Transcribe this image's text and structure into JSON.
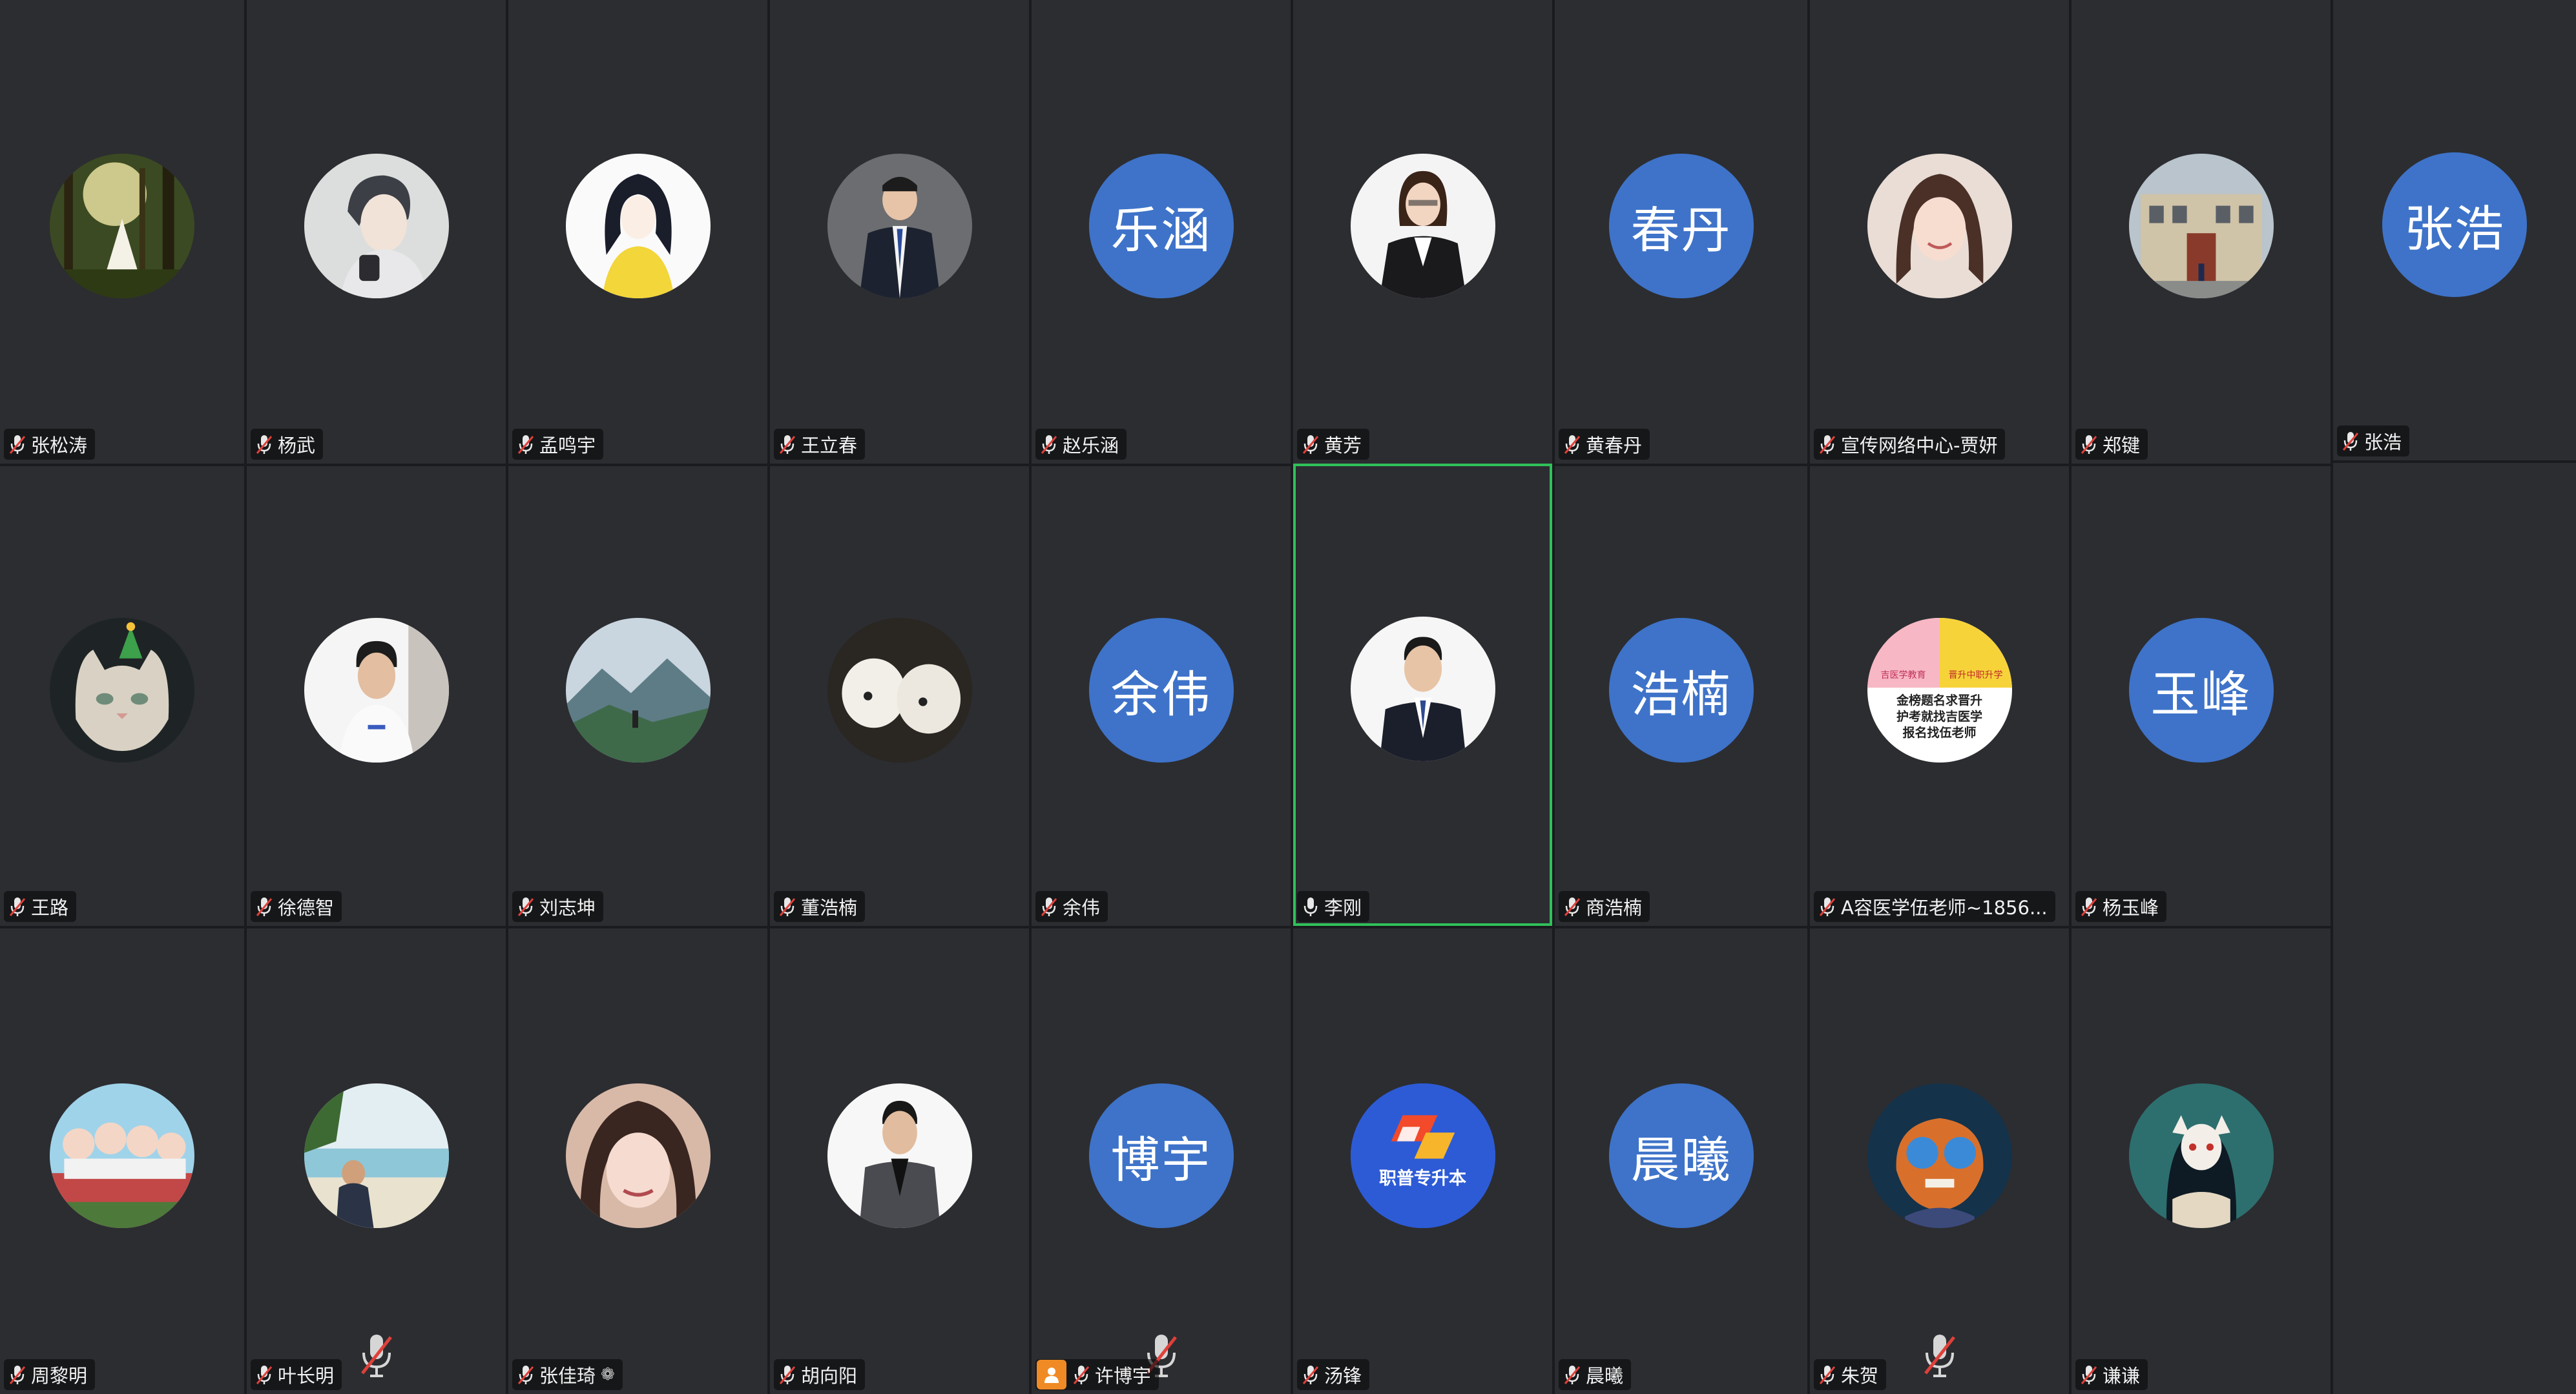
{
  "meeting": {
    "participants": [
      {
        "name": "张松涛",
        "avatar": "forest-photo",
        "muted": true
      },
      {
        "name": "杨武",
        "avatar": "anime-boy",
        "muted": true
      },
      {
        "name": "孟鸣宇",
        "avatar": "anime-girl",
        "muted": true
      },
      {
        "name": "王立春",
        "avatar": "man-in-suit",
        "muted": true
      },
      {
        "name": "赵乐涵",
        "avatar": "initials",
        "initials": "乐涵",
        "muted": true
      },
      {
        "name": "黄芳",
        "avatar": "woman-in-suit",
        "muted": true
      },
      {
        "name": "黄春丹",
        "avatar": "initials",
        "initials": "春丹",
        "muted": true
      },
      {
        "name": "宣传网络中心-贾妍",
        "avatar": "woman-portrait",
        "muted": true
      },
      {
        "name": "郑键",
        "avatar": "building-photo",
        "muted": true
      },
      {
        "name": "张浩",
        "avatar": "initials",
        "initials": "张浩",
        "muted": true
      },
      {
        "name": "王路",
        "avatar": "cat-photo",
        "muted": true
      },
      {
        "name": "徐德智",
        "avatar": "young-man",
        "muted": true
      },
      {
        "name": "刘志坤",
        "avatar": "mountain-photo",
        "muted": true
      },
      {
        "name": "董浩楠",
        "avatar": "puppies-photo",
        "muted": true
      },
      {
        "name": "余伟",
        "avatar": "initials",
        "initials": "余伟",
        "muted": true
      },
      {
        "name": "李刚",
        "avatar": "man-in-suit-2",
        "muted": false,
        "active_speaker": true
      },
      {
        "name": "商浩楠",
        "avatar": "initials",
        "initials": "浩楠",
        "muted": true
      },
      {
        "name": "A容医学伍老师~1856...",
        "avatar": "medical-ad",
        "muted": true
      },
      {
        "name": "杨玉峰",
        "avatar": "initials",
        "initials": "玉峰",
        "muted": true
      },
      {
        "name": "周黎明",
        "avatar": "cartoon-group",
        "muted": true
      },
      {
        "name": "叶长明",
        "avatar": "beach-photo",
        "muted": true,
        "big_mute": true
      },
      {
        "name": "张佳琦",
        "avatar": "girl-selfie",
        "muted": true,
        "suffix": "❁"
      },
      {
        "name": "胡向阳",
        "avatar": "man-in-suit-3",
        "muted": true
      },
      {
        "name": "许博宇",
        "avatar": "initials",
        "initials": "博宇",
        "muted": true,
        "big_mute": true,
        "host_badge": true
      },
      {
        "name": "汤锋",
        "avatar": "logo-zhiyu",
        "logo_text": "职普专升本",
        "muted": true
      },
      {
        "name": "晨曦",
        "avatar": "initials",
        "initials": "晨曦",
        "muted": true
      },
      {
        "name": "朱贺",
        "avatar": "cartoon-fox",
        "muted": true,
        "big_mute": true
      },
      {
        "name": "谦谦",
        "avatar": "anime-fox-girl",
        "muted": true
      }
    ]
  },
  "medical_ad": {
    "left_logo": "吉医学教育",
    "right_logo": "晋升中职升学",
    "line1": "金榜题名求晋升",
    "line2": "护考就找吉医学",
    "line3": "报名找伍老师"
  },
  "colors": {
    "background": "#1a1b1e",
    "tile": "#2c2d31",
    "initials_avatar": "#3e73c9",
    "active_border": "#2fc15a",
    "mute_red": "#e0403a"
  }
}
